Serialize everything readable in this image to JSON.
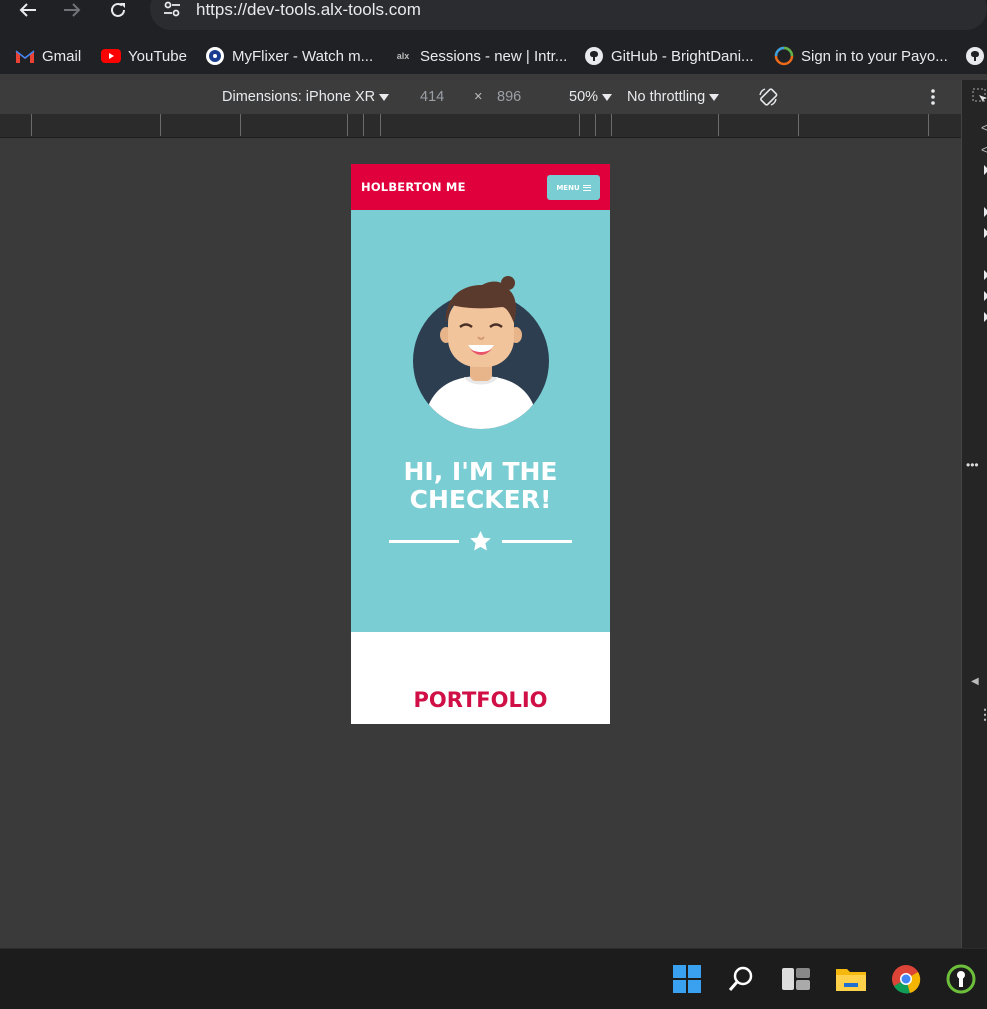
{
  "browser": {
    "url": "https://dev-tools.alx-tools.com",
    "bookmarks": [
      {
        "label": "Gmail",
        "icon": "gmail-icon"
      },
      {
        "label": "YouTube",
        "icon": "youtube-icon"
      },
      {
        "label": "MyFlixer - Watch m...",
        "icon": "myflixer-icon"
      },
      {
        "label": "Sessions - new | Intr...",
        "icon": "alx-icon"
      },
      {
        "label": "GitHub - BrightDani...",
        "icon": "github-icon"
      },
      {
        "label": "Sign in to your Payo...",
        "icon": "payoneer-icon"
      }
    ]
  },
  "device_toolbar": {
    "dimensions_label": "Dimensions: iPhone XR",
    "width": "414",
    "times": "×",
    "height": "896",
    "zoom": "50%",
    "throttling": "No throttling"
  },
  "page": {
    "brand": "HOLBERTON ME",
    "menu_label": "MENU",
    "hero_title_line1": "HI, I'M THE",
    "hero_title_line2": "CHECKER!",
    "portfolio_heading": "PORTFOLIO"
  },
  "colors": {
    "header_red": "#e0003c",
    "hero_teal": "#79cdd3",
    "portfolio_red": "#cf0f45"
  },
  "taskbar_icons": [
    "windows-start-icon",
    "search-icon",
    "task-view-icon",
    "file-explorer-icon",
    "chrome-icon",
    "app-icon"
  ]
}
